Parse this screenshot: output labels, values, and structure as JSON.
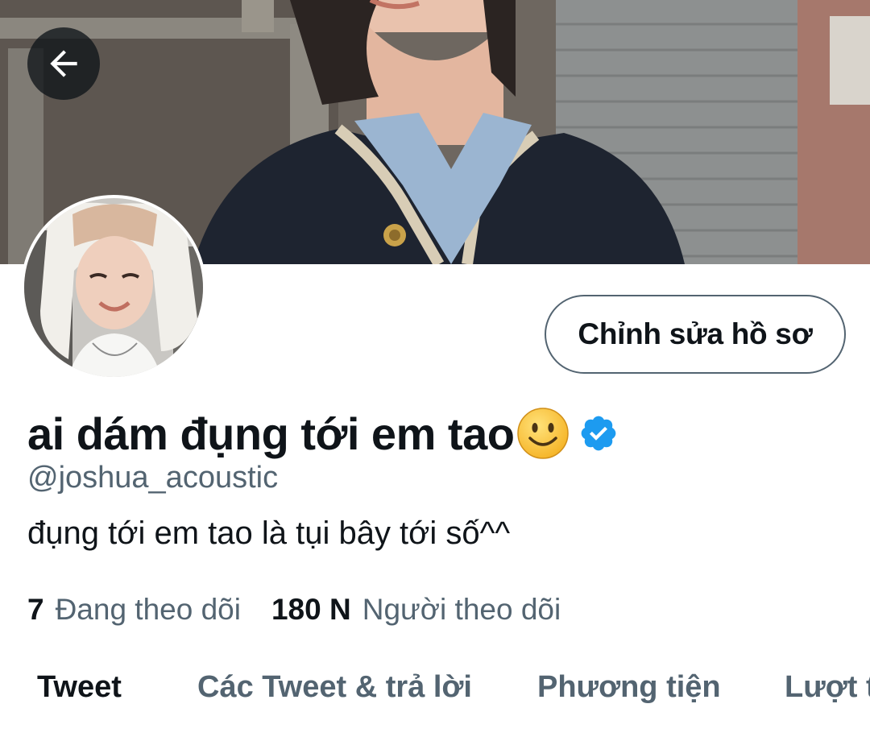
{
  "header": {
    "back_icon": "arrow-left-icon"
  },
  "profile": {
    "edit_button_label": "Chỉnh sửa hồ sơ",
    "display_name": "ai dám đụng tới em tao",
    "name_emoji_icon": "smiling-face-icon",
    "verified_icon": "verified-badge-icon",
    "handle": "@joshua_acoustic",
    "bio": "đụng tới em tao là tụi bây tới số^^"
  },
  "stats": {
    "following_count": "7",
    "following_label": "Đang theo dõi",
    "followers_count": "180 N",
    "followers_label": "Người theo dõi"
  },
  "tabs": [
    {
      "label": "Tweet",
      "active": true
    },
    {
      "label": "Các Tweet & trả lời",
      "active": false
    },
    {
      "label": "Phương tiện",
      "active": false
    },
    {
      "label": "Lượt thích",
      "active": false
    }
  ],
  "colors": {
    "verified_blue": "#1d9bf0",
    "text_primary": "#0f1419",
    "text_secondary": "#536471"
  }
}
